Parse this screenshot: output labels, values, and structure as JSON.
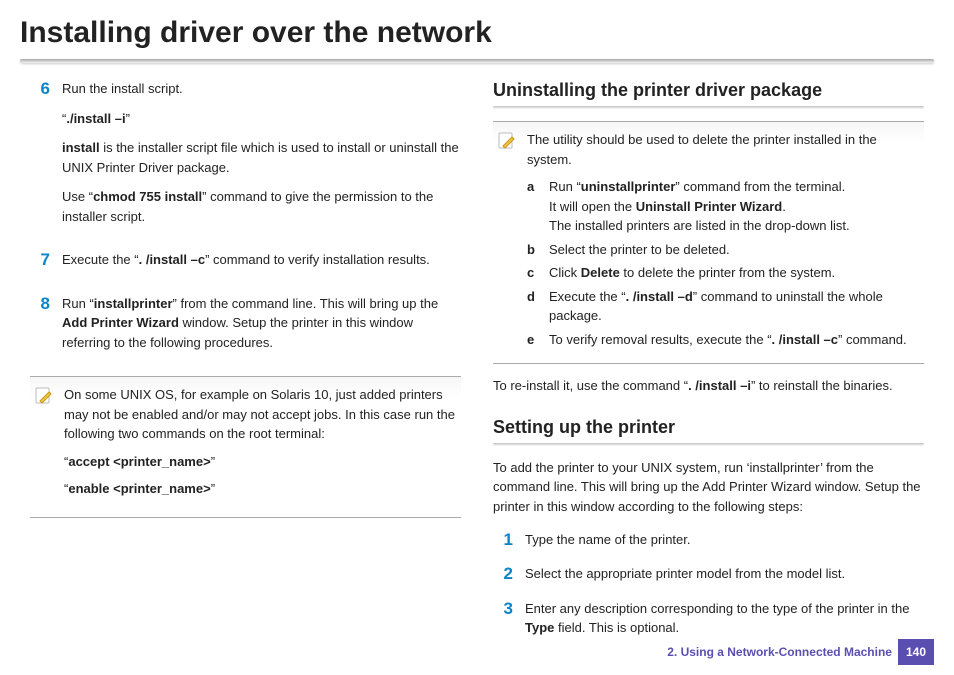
{
  "title": "Installing driver over the network",
  "col1": {
    "steps": [
      {
        "num": "6",
        "paras": [
          "Run the install script.",
          "“<b>./install –i</b>”",
          "<b>install</b> is the installer script file which is used to install or uninstall the UNIX Printer Driver package.",
          "Use “<b>chmod 755 install</b>” command to give the permission to the installer script."
        ]
      },
      {
        "num": "7",
        "paras": [
          "Execute the “<b>. /install –c</b>” command to verify installation results."
        ]
      },
      {
        "num": "8",
        "paras": [
          "Run “<b>installprinter</b>” from the command line. This will bring up the <b>Add Printer Wizard</b> window. Setup the printer in this window referring to the following procedures."
        ]
      }
    ],
    "note": {
      "paras": [
        "On some UNIX OS, for example on Solaris 10, just added printers may not be enabled and/or may not accept jobs. In this case run the following two commands on the root terminal:",
        "“<b>accept &lt;printer_name&gt;</b>”",
        "“<b>enable &lt;printer_name&gt;</b>”"
      ]
    }
  },
  "col2": {
    "sec1": {
      "heading": "Uninstalling the printer driver package",
      "note_top": "The utility should be used to delete the printer installed in the system.",
      "items": [
        {
          "letter": "a",
          "html": "Run “<b>uninstallprinter</b>” command from the terminal.<br>It will open the <b>Uninstall Printer Wizard</b>.<br>The installed printers are listed in the drop-down list."
        },
        {
          "letter": "b",
          "html": "Select the printer to be deleted."
        },
        {
          "letter": "c",
          "html": "Click <b>Delete</b> to delete the printer from the system."
        },
        {
          "letter": "d",
          "html": "Execute the “<b>. /install –d</b>” command to uninstall the whole package."
        },
        {
          "letter": "e",
          "html": "To verify removal results, execute the “<b>. /install –c</b>” command."
        }
      ],
      "after": "To re-install it, use the command “<b>. /install –i</b>” to reinstall the binaries."
    },
    "sec2": {
      "heading": "Setting up the printer",
      "intro": "To add the printer to your UNIX system, run ‘installprinter’ from the command line. This will bring up the Add Printer Wizard window. Setup the printer in this window according to the following steps:",
      "steps": [
        {
          "num": "1",
          "html": "Type the name of the printer."
        },
        {
          "num": "2",
          "html": "Select the appropriate printer model from the model list."
        },
        {
          "num": "3",
          "html": "Enter any description corresponding to the type of the printer in the <b>Type</b> field. This is optional."
        }
      ]
    }
  },
  "footer": {
    "chapter": "2.  Using a Network-Connected Machine",
    "page": "140"
  }
}
